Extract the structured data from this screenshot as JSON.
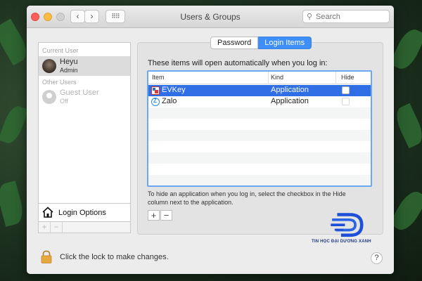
{
  "window": {
    "title": "Users & Groups",
    "search_placeholder": "Search"
  },
  "sidebar": {
    "current_user_label": "Current User",
    "other_users_label": "Other Users",
    "users": [
      {
        "name": "Heyu",
        "role": "Admin"
      },
      {
        "name": "Guest User",
        "role": "Off"
      }
    ],
    "login_options_label": "Login Options",
    "add_label": "+",
    "remove_label": "−"
  },
  "tabs": [
    "Password",
    "Login Items"
  ],
  "active_tab": "Login Items",
  "login_items": {
    "intro": "These items will open automatically when you log in:",
    "columns": [
      "Item",
      "Kind",
      "Hide"
    ],
    "rows": [
      {
        "item": "EVKey",
        "kind": "Application",
        "hide": false,
        "icon": "evkey-app-icon"
      },
      {
        "item": "Zalo",
        "kind": "Application",
        "hide": false,
        "icon": "zalo-app-icon"
      }
    ],
    "hint": "To hide an application when you log in, select the checkbox in the Hide column next to the application.",
    "add_label": "+",
    "remove_label": "−"
  },
  "footer": {
    "lock_text": "Click the lock to make changes.",
    "help_label": "?"
  },
  "watermark": {
    "text": "TIN HỌC ĐẠI DƯƠNG XANH"
  },
  "colors": {
    "accent": "#3e8ef7",
    "selection": "#2f6ee5"
  }
}
